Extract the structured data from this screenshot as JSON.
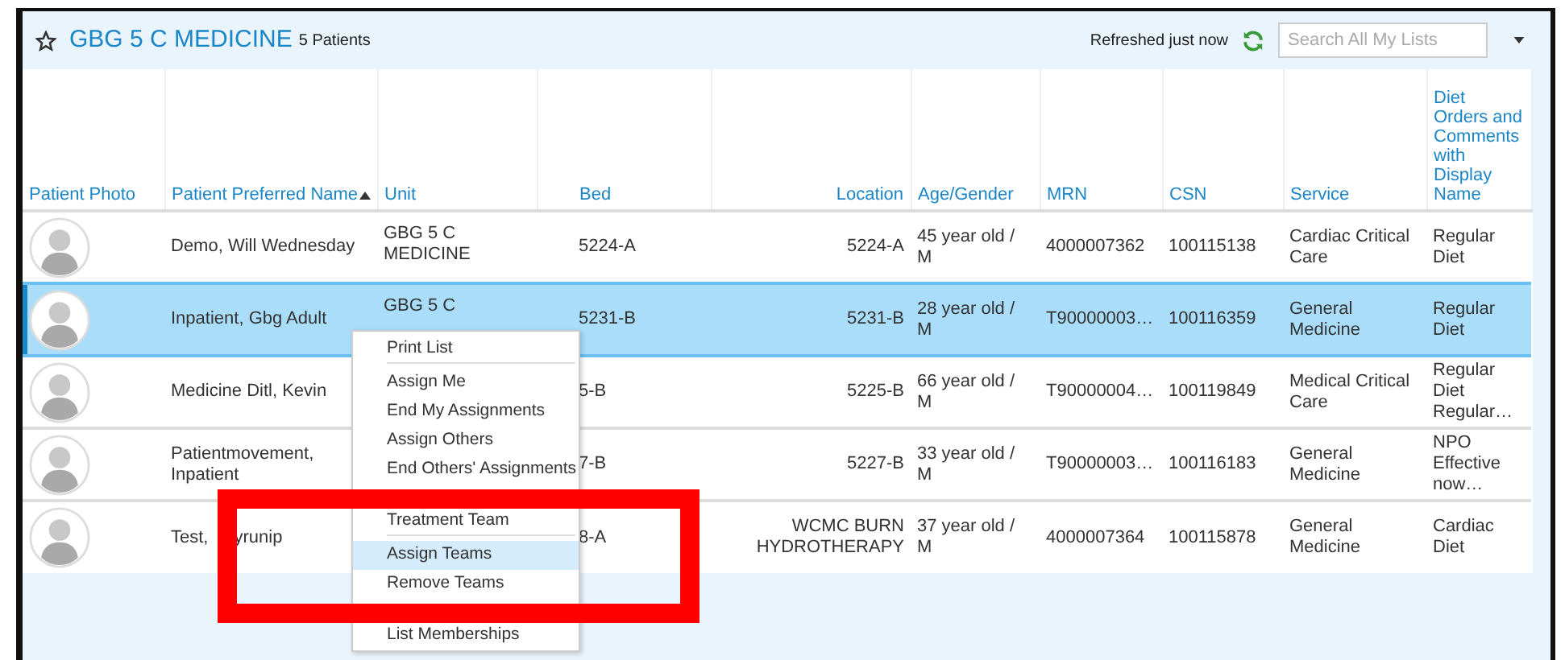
{
  "list_header": {
    "title": "GBG 5 C MEDICINE",
    "count": "5 Patients",
    "refresh_status": "Refreshed just now",
    "search": {
      "placeholder": "Search All My Lists"
    }
  },
  "table": {
    "columns": [
      {
        "label": "Patient Photo",
        "sorted": false
      },
      {
        "label": "Patient Preferred Name",
        "sorted": true
      },
      {
        "label": "Unit",
        "sorted": false
      },
      {
        "label": "Bed",
        "sorted": false
      },
      {
        "label": "Location",
        "sorted": false
      },
      {
        "label": "Age/Gender",
        "sorted": false
      },
      {
        "label": "MRN",
        "sorted": false
      },
      {
        "label": "CSN",
        "sorted": false
      },
      {
        "label": "Service",
        "sorted": false
      },
      {
        "label": "Diet Orders and Comments with Display Name",
        "sorted": false
      }
    ],
    "rows": [
      {
        "selected": false,
        "name": [
          "Demo, Will Wednesday"
        ],
        "unit": "GBG 5 C MEDICINE",
        "bed": "5224-A",
        "location": "5224-A",
        "age_gender": "45 year old / M",
        "mrn": "4000007362",
        "csn": "100115138",
        "service": "Cardiac Critical Care",
        "diet": "Regular Diet"
      },
      {
        "selected": true,
        "name": [
          "Inpatient, Gbg Adult"
        ],
        "unit": "GBG 5 C",
        "bed": "5231-B",
        "location": "5231-B",
        "age_gender": "28 year old / M",
        "mrn": "T90000003…",
        "csn": "100116359",
        "service": "General Medicine",
        "diet": "Regular Diet"
      },
      {
        "selected": false,
        "name": [
          "Medicine Ditl, Kevin"
        ],
        "bed": "5-B",
        "location": "5225-B",
        "age_gender": "66 year old / M",
        "mrn": "T90000004…",
        "csn": "100119849",
        "service": "Medical Critical Care",
        "diet": "Regular Diet Regular…"
      },
      {
        "selected": false,
        "name": [
          "Patientmovement, Inpatient"
        ],
        "bed": "7-B",
        "location": "5227-B",
        "age_gender": "33 year old / M",
        "mrn": "T90000003…",
        "csn": "100116183",
        "service": "General Medicine",
        "diet": "NPO Effective now…"
      },
      {
        "selected": false,
        "name": [
          "Test,",
          "yrunip"
        ],
        "bed": "8-A",
        "location": "WCMC BURN HYDROTHERAPY",
        "age_gender": "37 year old / M",
        "mrn": "4000007364",
        "csn": "100115878",
        "service": "General Medicine",
        "diet": "Cardiac Diet"
      }
    ]
  },
  "context_menu": {
    "items": [
      {
        "label": "Print List",
        "selected": false,
        "divider_after": true
      },
      {
        "label": "Assign Me",
        "selected": false,
        "divider_after": false
      },
      {
        "label": "End My Assignments",
        "selected": false,
        "divider_after": false
      },
      {
        "label": "Assign Others",
        "selected": false,
        "divider_after": false
      },
      {
        "label": "End Others' Assignments",
        "selected": false,
        "divider_after": false
      },
      {
        "label": "Treatment Team",
        "selected": false,
        "divider_after": true
      },
      {
        "label": "Assign Teams",
        "selected": true,
        "divider_after": false
      },
      {
        "label": "Remove Teams",
        "selected": false,
        "divider_after": false
      },
      {
        "label": "List Memberships",
        "selected": false,
        "divider_after": false
      }
    ]
  }
}
